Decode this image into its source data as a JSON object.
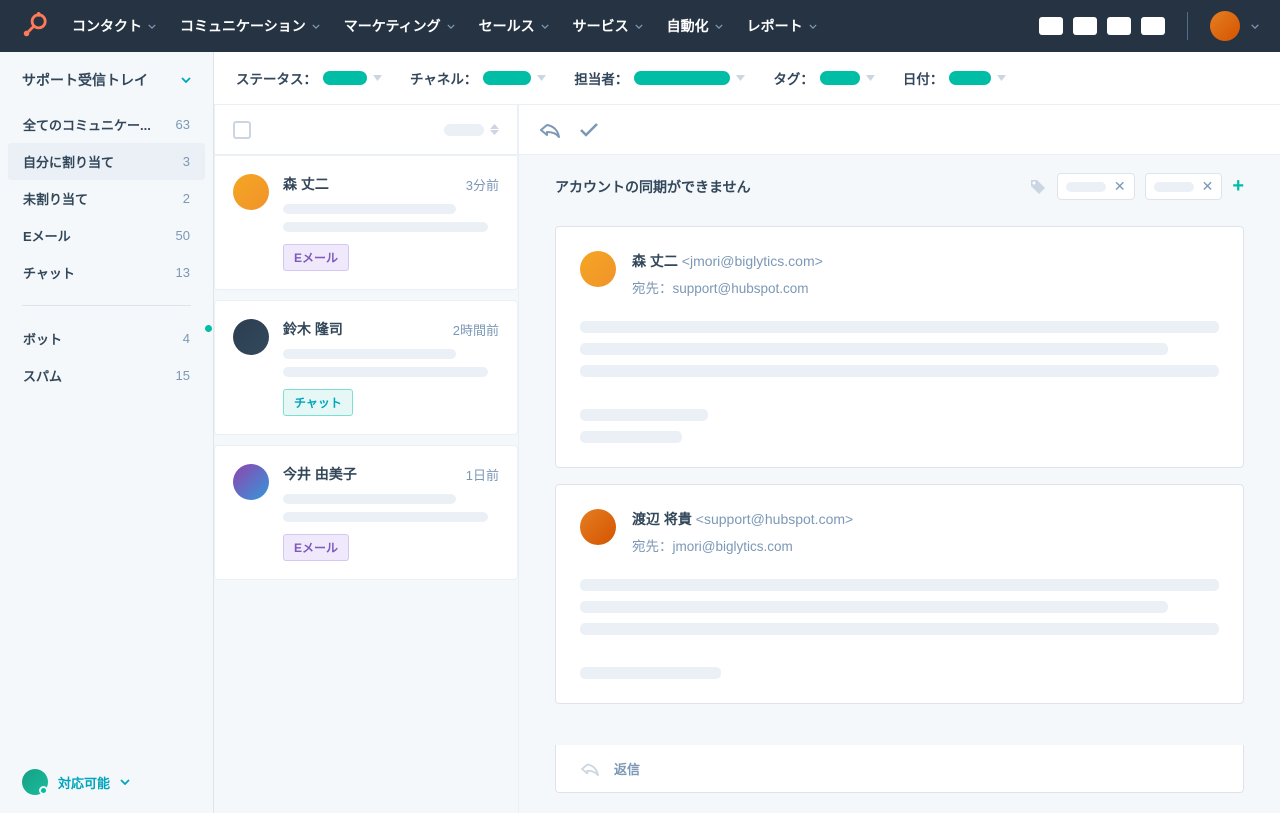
{
  "nav": {
    "items": [
      "コンタクト",
      "コミュニケーション",
      "マーケティング",
      "セールス",
      "サービス",
      "自動化",
      "レポート"
    ]
  },
  "sidebar": {
    "title": "サポート受信トレイ",
    "items": [
      {
        "label": "全てのコミュニケー...",
        "count": "63"
      },
      {
        "label": "自分に割り当て",
        "count": "3"
      },
      {
        "label": "未割り当て",
        "count": "2"
      },
      {
        "label": "Eメール",
        "count": "50"
      },
      {
        "label": "チャット",
        "count": "13"
      }
    ],
    "items2": [
      {
        "label": "ボット",
        "count": "4"
      },
      {
        "label": "スパム",
        "count": "15"
      }
    ],
    "status": "対応可能"
  },
  "filters": {
    "status": "ステータス：",
    "channel": "チャネル：",
    "assignee": "担当者：",
    "tag": "タグ：",
    "date": "日付："
  },
  "conversations": [
    {
      "name": "森 丈二",
      "time": "3分前",
      "badge": "Eメール",
      "badgeClass": "badge-email"
    },
    {
      "name": "鈴木 隆司",
      "time": "2時間前",
      "badge": "チャット",
      "badgeClass": "badge-chat",
      "unread": true
    },
    {
      "name": "今井 由美子",
      "time": "1日前",
      "badge": "Eメール",
      "badgeClass": "badge-email"
    }
  ],
  "detail": {
    "subject": "アカウントの同期ができません",
    "messages": [
      {
        "from": "森 丈二",
        "fromAddr": "<jmori@biglytics.com>",
        "toPrefix": "宛先：",
        "to": "support@hubspot.com"
      },
      {
        "from": "渡辺 将貴",
        "fromAddr": "<support@hubspot.com>",
        "toPrefix": "宛先：",
        "to": "jmori@biglytics.com"
      }
    ],
    "reply": "返信"
  }
}
